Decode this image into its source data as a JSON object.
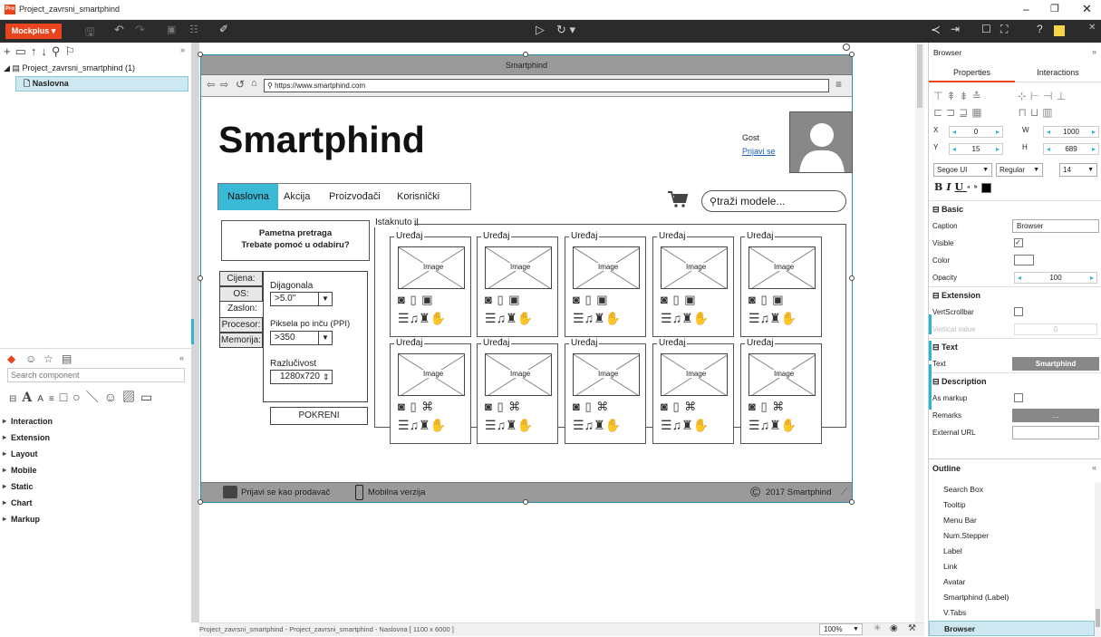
{
  "window": {
    "title": "Project_zavrsni_smartphind",
    "app_icon": "Pro"
  },
  "toolbar": {
    "brand": "Mockplus ▾"
  },
  "tree": {
    "project": "Project_zavrsni_smartphind (1)",
    "page": "Naslovna"
  },
  "components": {
    "search_placeholder": "Search component",
    "categories": [
      "Interaction",
      "Extension",
      "Layout",
      "Mobile",
      "Static",
      "Chart",
      "Markup"
    ]
  },
  "browser": {
    "title": "Smartphind",
    "url": "https://www.smartphind.com"
  },
  "site": {
    "logo": "Smartphind",
    "guest": "Gost",
    "login": "Prijavi se",
    "nav": [
      "Naslovna",
      "Akcija",
      "Proizvođači",
      "Korisnički profil"
    ],
    "search_placeholder": "traži modele...",
    "callout_line1": "Pametna pretraga",
    "callout_line2": "Trebate pomoć u odabiru?",
    "filter_tabs": [
      "Cijena:",
      "OS:",
      "Zaslon:",
      "Procesor:",
      "Memorija:"
    ],
    "diag_label": "Dijagonala",
    "diag_value": ">5.0\"",
    "ppi_label": "Piksela po inču (PPI)",
    "ppi_value": ">350",
    "res_label": "Razlučivost",
    "res_value": "1280x720",
    "run_button": "POKRENI",
    "featured": "Istaknuto",
    "card_title": "Uređaj",
    "image_label": "Image",
    "footer_seller": "Prijavi se kao prodavač",
    "footer_mobile": "Mobilna verzija",
    "footer_copy": "2017 Smartphind"
  },
  "status": {
    "path": "Project_zavrsni_smartphind - Project_zavrsni_smartphind - Naslovna [ 1100 x 6000 ]",
    "zoom": "100%"
  },
  "props": {
    "header": "Browser",
    "tab_properties": "Properties",
    "tab_interactions": "Interactions",
    "x": "0",
    "y": "15",
    "w": "1000",
    "h": "689",
    "x_label": "X",
    "y_label": "Y",
    "w_label": "W",
    "h_label": "H",
    "font": "Segoe UI",
    "weight": "Regular",
    "size": "14",
    "sec_basic": "Basic",
    "caption_label": "Caption",
    "caption_value": "Browser",
    "visible_label": "Visible",
    "color_label": "Color",
    "opacity_label": "Opacity",
    "opacity_value": "100",
    "sec_extension": "Extension",
    "vscroll_label": "VertScrollbar",
    "vvalue_label": "Vertical value",
    "vvalue_value": "0",
    "sec_text": "Text",
    "text_label": "Text",
    "text_value": "Smartphind",
    "sec_desc": "Description",
    "markup_label": "As markup",
    "remarks_label": "Remarks",
    "remarks_value": "...",
    "url_label": "External URL"
  },
  "outline": {
    "title": "Outline",
    "items": [
      "Search Box",
      "Tooltip",
      "Menu Bar",
      "Num.Stepper",
      "Label",
      "Link",
      "Avatar",
      "Smartphind (Label)",
      "V.Tabs",
      "Browser"
    ]
  }
}
